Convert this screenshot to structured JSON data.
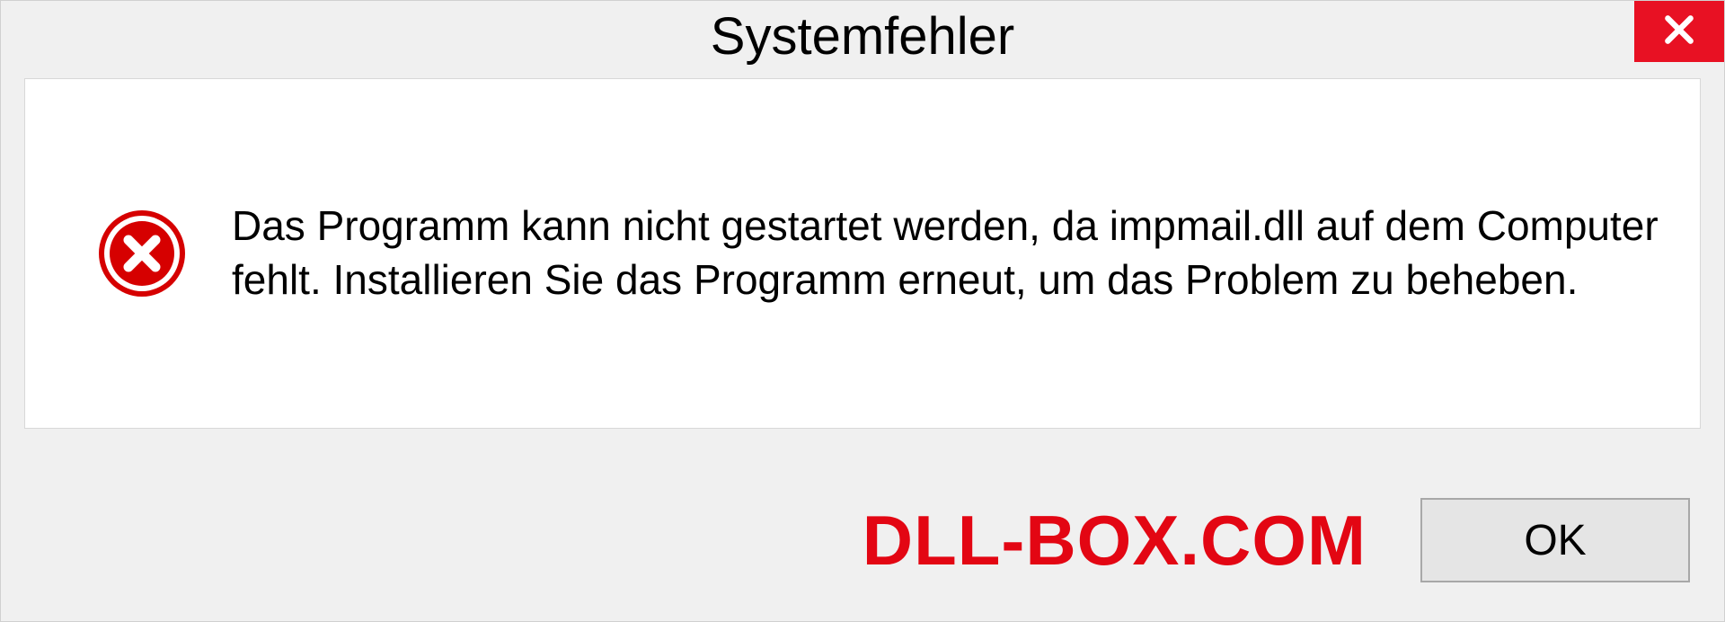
{
  "dialog": {
    "title": "Systemfehler",
    "message": "Das Programm kann nicht gestartet werden, da impmail.dll auf dem Computer fehlt. Installieren Sie das Programm erneut, um das Problem zu beheben.",
    "ok_label": "OK"
  },
  "watermark": "DLL-BOX.COM",
  "colors": {
    "close_bg": "#e81123",
    "error_red": "#d60000",
    "watermark_red": "#e30613"
  }
}
